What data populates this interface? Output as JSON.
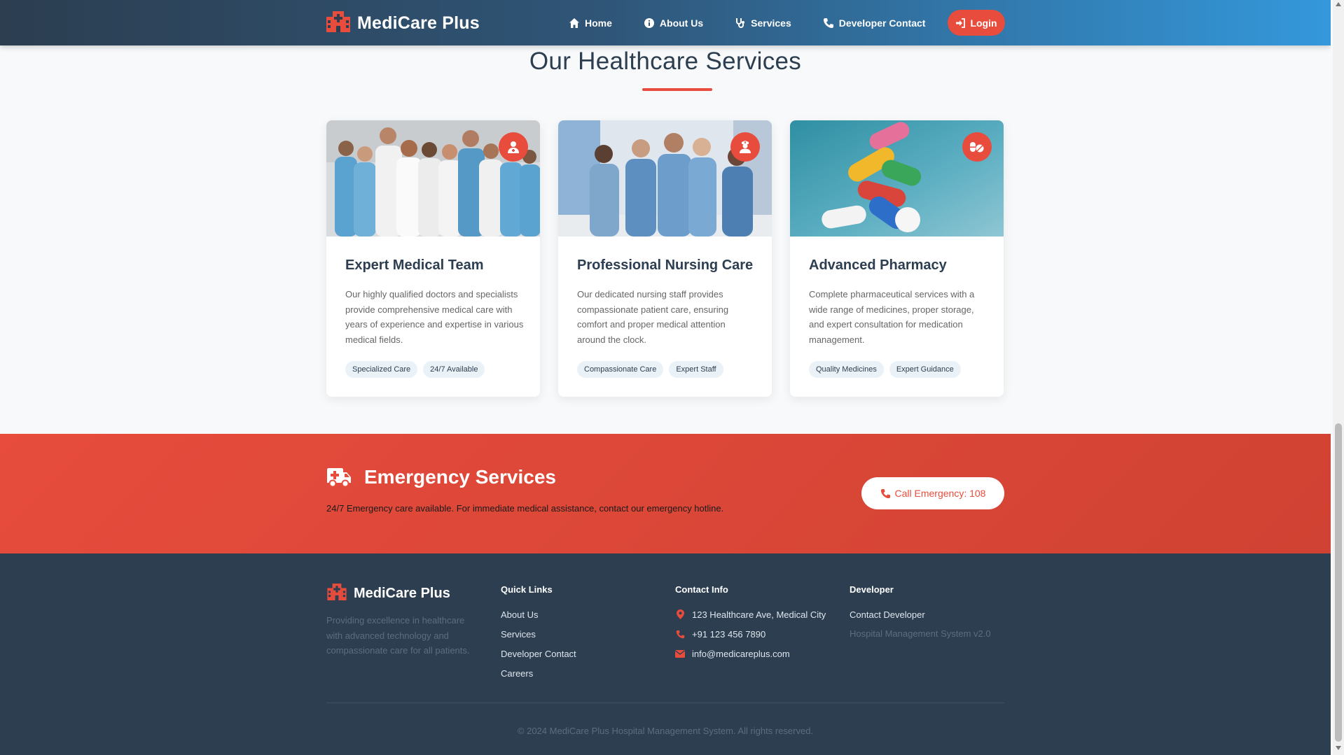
{
  "brand": {
    "name": "MediCare Plus",
    "icon": "hospital-icon"
  },
  "nav": {
    "items": [
      {
        "label": "Home",
        "icon": "home-icon"
      },
      {
        "label": "About Us",
        "icon": "info-icon"
      },
      {
        "label": "Services",
        "icon": "stethoscope-icon"
      },
      {
        "label": "Developer Contact",
        "icon": "phone-icon"
      }
    ],
    "login": {
      "label": "Login",
      "icon": "sign-in-icon"
    }
  },
  "services": {
    "title": "Our Healthcare Services",
    "cards": [
      {
        "title": "Expert Medical Team",
        "description": "Our highly qualified doctors and specialists provide comprehensive medical care with years of experience and expertise in various medical fields.",
        "badge_icon": "user-doctor-icon",
        "tags": [
          "Specialized Care",
          "24/7 Available"
        ]
      },
      {
        "title": "Professional Nursing Care",
        "description": "Our dedicated nursing staff provides compassionate patient care, ensuring comfort and proper medical attention around the clock.",
        "badge_icon": "user-nurse-icon",
        "tags": [
          "Compassionate Care",
          "Expert Staff"
        ]
      },
      {
        "title": "Advanced Pharmacy",
        "description": "Complete pharmaceutical services with a wide range of medicines, proper storage, and expert consultation for medication management.",
        "badge_icon": "pills-icon",
        "tags": [
          "Quality Medicines",
          "Expert Guidance"
        ]
      }
    ]
  },
  "emergency": {
    "title": "Emergency Services",
    "icon": "ambulance-icon",
    "text": "24/7 Emergency care available. For immediate medical assistance, contact our emergency hotline.",
    "button": "Call Emergency: 108"
  },
  "footer": {
    "brand": "MediCare Plus",
    "about": "Providing excellence in healthcare with advanced technology and compassionate care for all patients.",
    "quick_links": {
      "title": "Quick Links",
      "items": [
        "About Us",
        "Services",
        "Developer Contact",
        "Careers"
      ]
    },
    "contact": {
      "title": "Contact Info",
      "address": "123 Healthcare Ave, Medical City",
      "phone": "+91 123 456 7890",
      "email": "info@medicareplus.com"
    },
    "developer": {
      "title": "Developer",
      "link": "Contact Developer",
      "version": "Hospital Management System v2.0"
    },
    "copyright": "© 2024 MediCare Plus Hospital Management System. All rights reserved."
  },
  "colors": {
    "accent": "#e74c3c",
    "navy": "#2c3e50",
    "blue": "#3498db",
    "tag_bg": "#eaf2f8"
  }
}
